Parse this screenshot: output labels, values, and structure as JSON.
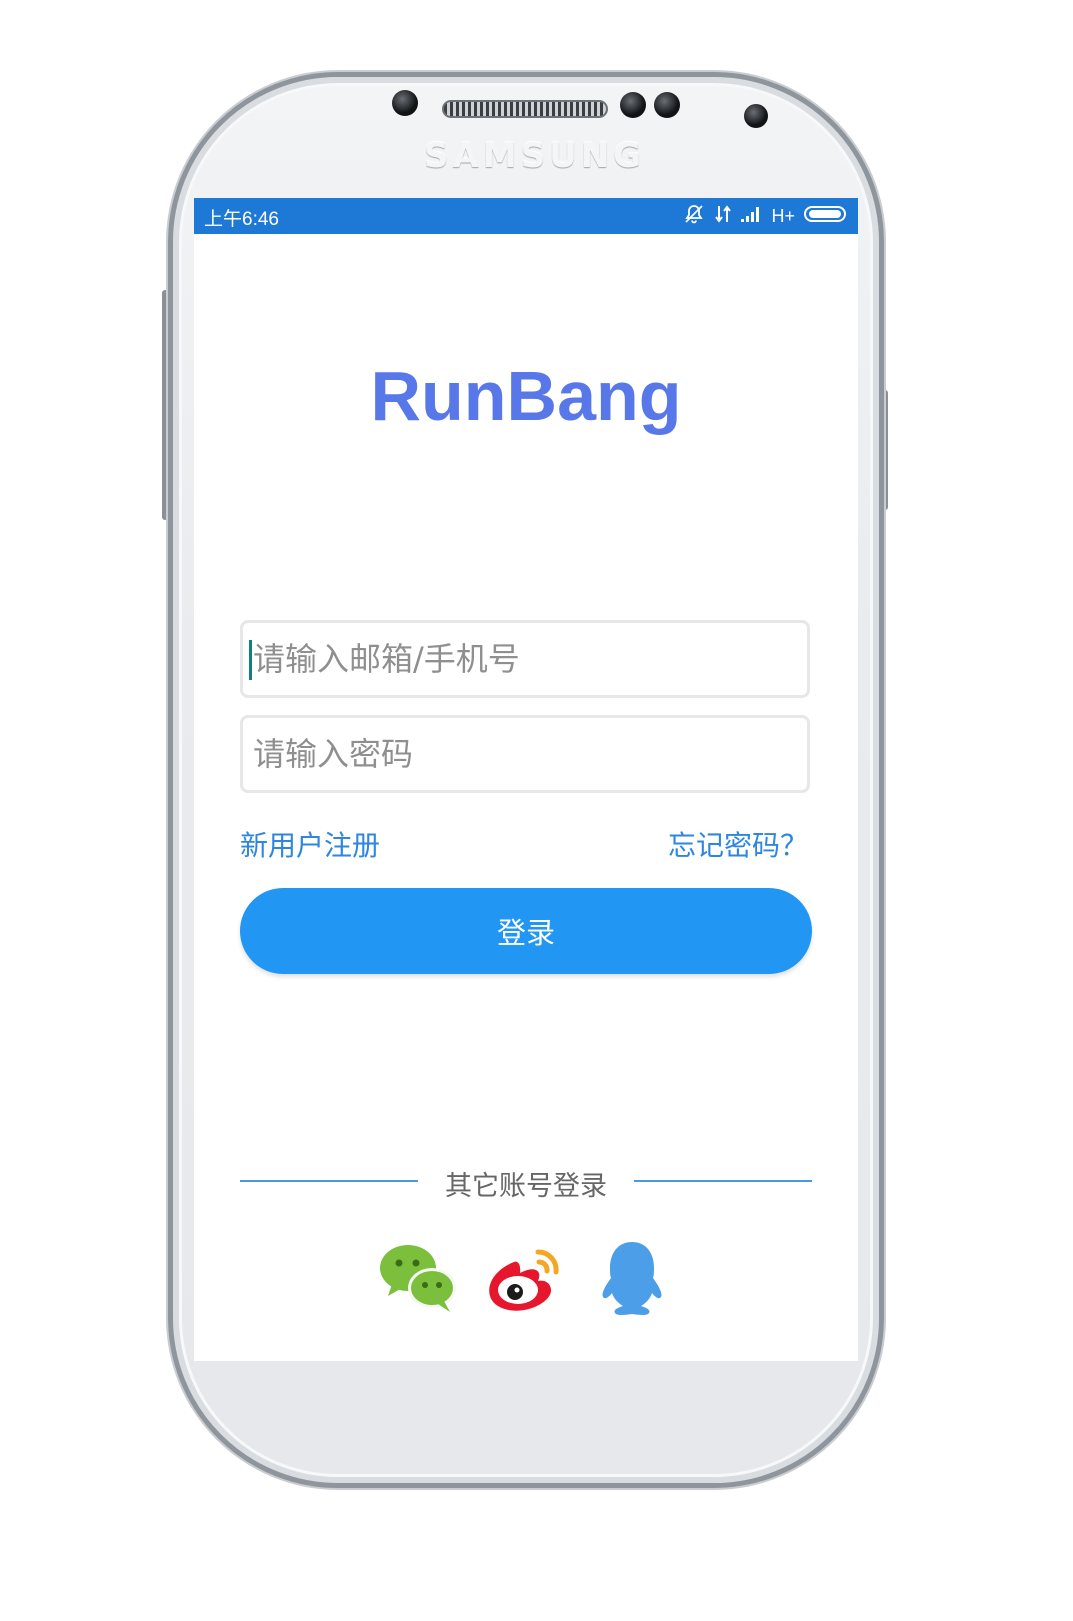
{
  "device": {
    "brand": "SAMSUNG"
  },
  "status_bar": {
    "time": "上午6:46",
    "network": "H+",
    "bg_color": "#1e78d6",
    "icons": [
      "alarm-muted-icon",
      "data-transfer-icon",
      "signal-icon",
      "battery-icon"
    ]
  },
  "app": {
    "title": "RunBang",
    "title_color": "#5877e8"
  },
  "login_form": {
    "email_placeholder": "请输入邮箱/手机号",
    "email_value": "",
    "password_placeholder": "请输入密码",
    "password_value": "",
    "register_link": "新用户注册",
    "forgot_link": "忘记密码？",
    "submit_label": "登录",
    "accent_color": "#2196f3"
  },
  "third_party": {
    "label": "其它账号登录",
    "providers": [
      "wechat-icon",
      "weibo-icon",
      "qq-icon"
    ]
  }
}
